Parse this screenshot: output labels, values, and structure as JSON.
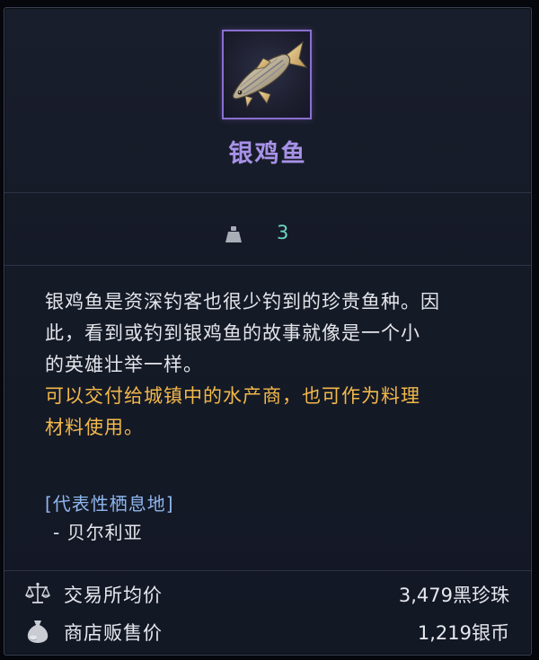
{
  "item": {
    "name": "银鸡鱼",
    "icon": "silver-fish-icon",
    "rarity_color": "#a892e8",
    "frame_color": "#8a6fd0"
  },
  "weight": {
    "icon": "weight-icon",
    "value": "3",
    "color": "#6dd6c0"
  },
  "description": {
    "lines": [
      "银鸡鱼是资深钓客也很少钓到的珍贵鱼种。因",
      "此，看到或钓到银鸡鱼的故事就像是一个小",
      "的英雄壮举一样。"
    ],
    "highlight_lines": [
      "可以交付给城镇中的水产商，也可作为料理",
      "材料使用。"
    ],
    "highlight_color": "#f2b84a"
  },
  "habitat": {
    "title": "[代表性栖息地]",
    "items": [
      "- 贝尔利亚"
    ],
    "title_color": "#8fb6ee"
  },
  "prices": [
    {
      "icon": "scale-icon",
      "label": "交易所均价",
      "value": "3,479黑珍珠"
    },
    {
      "icon": "money-bag-icon",
      "label": "商店贩售价",
      "value": "1,219银币"
    }
  ]
}
